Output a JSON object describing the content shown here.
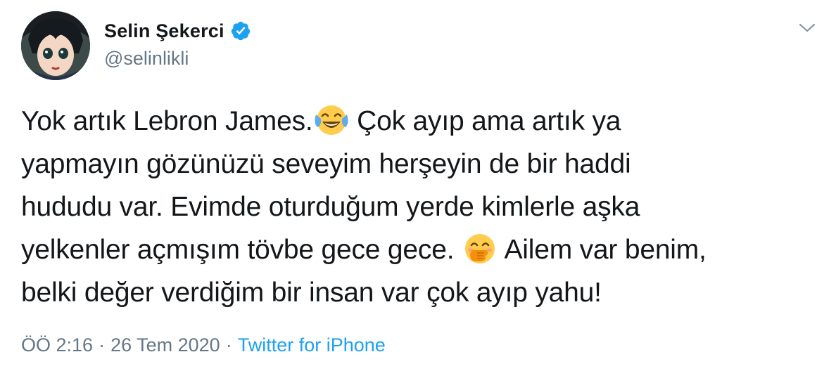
{
  "author": {
    "display_name": "Selin Şekerci",
    "handle": "@selinlikli",
    "verified": true
  },
  "tweet": {
    "lines": [
      {
        "segments": [
          {
            "type": "text",
            "value": "Yok artık Lebron James."
          },
          {
            "type": "emoji",
            "icon": "tears-of-joy-emoji"
          },
          {
            "type": "text",
            "value": " Çok ayıp ama artık ya"
          }
        ]
      },
      {
        "segments": [
          {
            "type": "text",
            "value": "yapmayın gözünüzü seveyim herşeyin de bir haddi"
          }
        ]
      },
      {
        "segments": [
          {
            "type": "text",
            "value": "hududu var. Evimde oturduğum yerde kimlerle aşka"
          }
        ]
      },
      {
        "segments": [
          {
            "type": "text",
            "value": "yelkenler açmışım tövbe gece gece. "
          },
          {
            "type": "emoji",
            "icon": "hand-over-mouth-emoji"
          },
          {
            "type": "text",
            "value": " Ailem var benim,"
          }
        ]
      },
      {
        "segments": [
          {
            "type": "text",
            "value": "belki değer verdiğim bir insan var çok ayıp yahu!"
          }
        ]
      }
    ]
  },
  "meta": {
    "time": "ÖÖ 2:16",
    "separator": "·",
    "date": "26 Tem 2020",
    "source": "Twitter for iPhone"
  },
  "icons": {
    "verified": "verified-badge-icon",
    "menu": "chevron-down-icon"
  },
  "colors": {
    "text": "#14171a",
    "secondary": "#657786",
    "link": "#1da1f2"
  }
}
